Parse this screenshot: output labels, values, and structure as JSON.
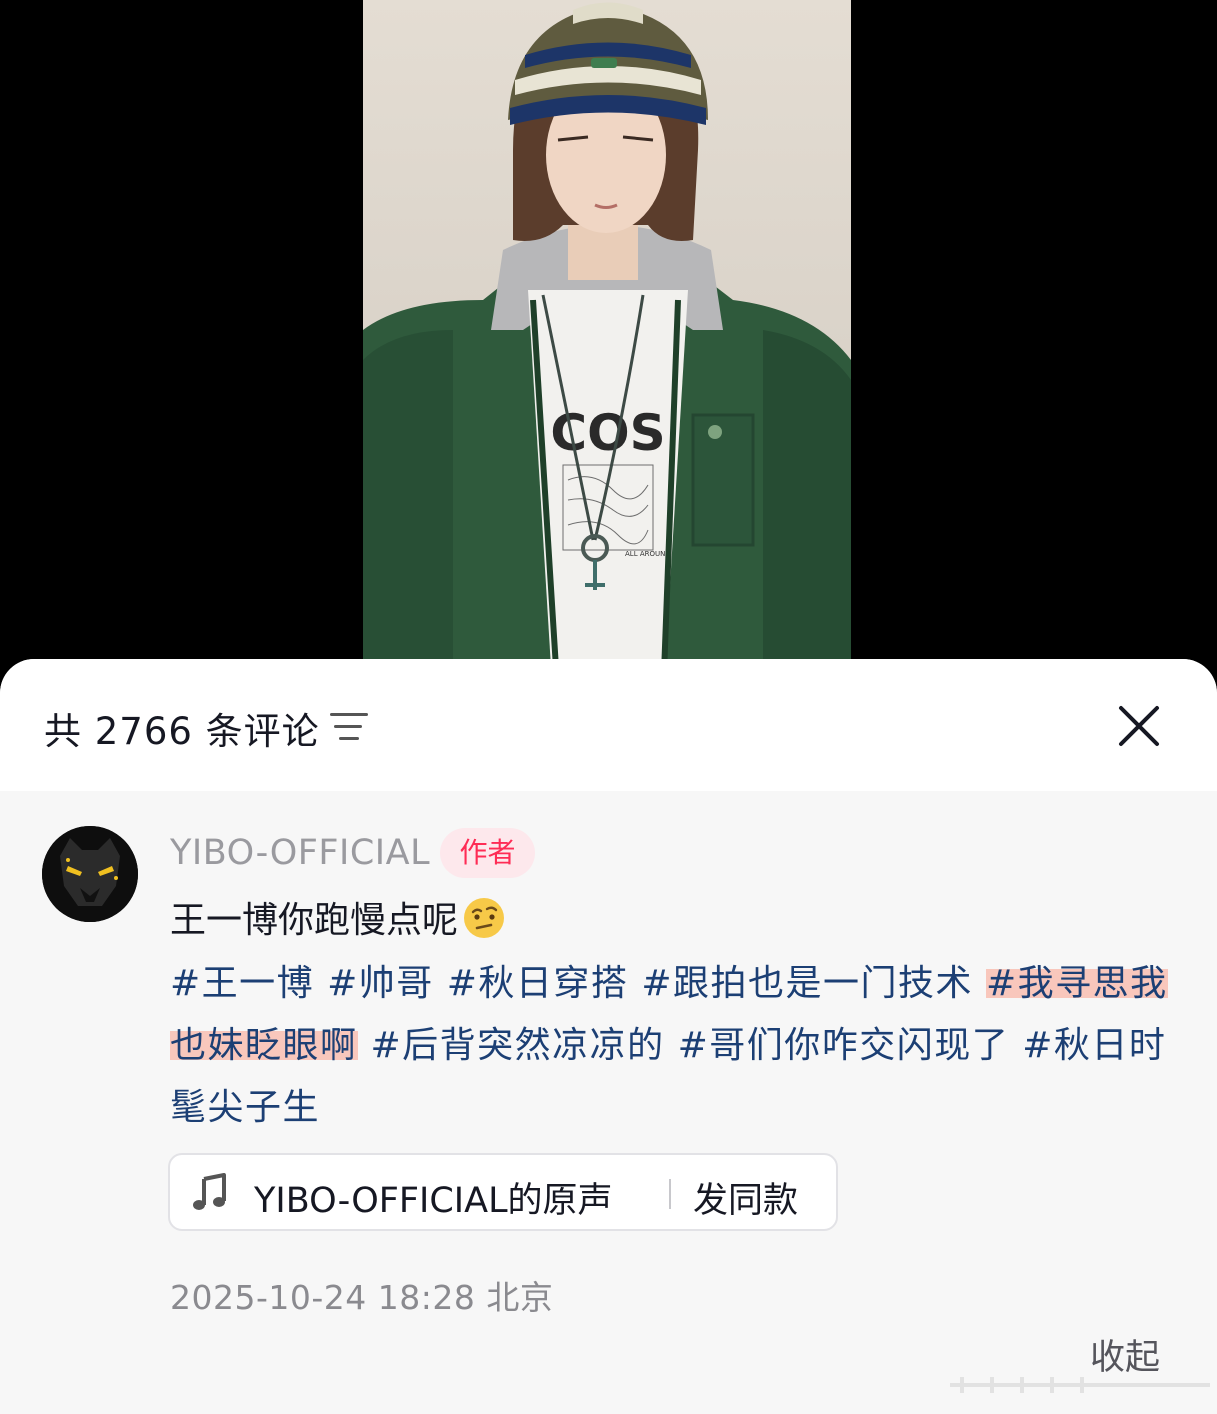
{
  "video": {
    "shirt_print": "COS",
    "shirt_small_print": "ALL AROUND"
  },
  "header": {
    "comment_count": "共 2766 条评论",
    "sort_icon": "sort-lines-icon",
    "close_icon": "close-x-icon"
  },
  "comment": {
    "author": "YIBO-OFFICIAL",
    "badge": "作者",
    "text": "王一博你跑慢点呢",
    "emoji": "thinking-face-emoji",
    "hashtags": [
      "#王一博",
      "#帅哥",
      "#秋日穿搭",
      "#跟拍也是一门技术",
      "#我寻思我也妹眨眼啊",
      "#后背突然凉凉的",
      "#哥们你咋交闪现了",
      "#秋日时髦尖子生"
    ],
    "music": {
      "icon": "music-note-icon",
      "label": "YIBO-OFFICIAL的原声",
      "action": "发同款"
    },
    "timestamp": "2025-10-24 18:28",
    "location": "北京",
    "collapse": "收起"
  },
  "colors": {
    "accent": "#fe2c55",
    "hashtag": "#1c3f74",
    "highlight": "#faa08c"
  }
}
